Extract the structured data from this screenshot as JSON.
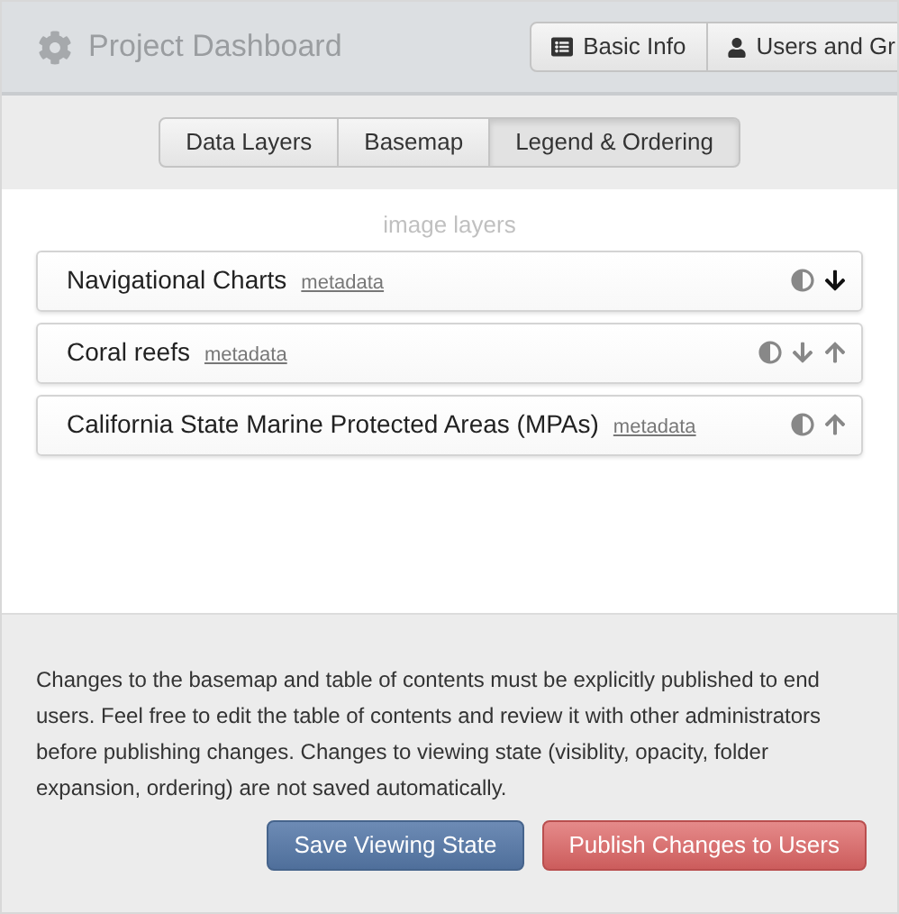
{
  "header": {
    "title": "Project Dashboard",
    "nav": [
      {
        "label": "Basic Info",
        "kind": "list"
      },
      {
        "label": "Users and Gr",
        "kind": "user"
      }
    ]
  },
  "tabs": [
    {
      "label": "Data Layers",
      "selected": false
    },
    {
      "label": "Basemap",
      "selected": false
    },
    {
      "label": "Legend & Ordering",
      "selected": true
    }
  ],
  "section_label": "image layers",
  "layers": [
    {
      "name": "Navigational Charts",
      "link": "metadata",
      "controls": [
        {
          "kind": "opacity",
          "active": false
        },
        {
          "kind": "down",
          "active": true
        }
      ]
    },
    {
      "name": "Coral reefs",
      "link": "metadata",
      "controls": [
        {
          "kind": "opacity",
          "active": false
        },
        {
          "kind": "down",
          "active": false
        },
        {
          "kind": "up",
          "active": false
        }
      ]
    },
    {
      "name": "California State Marine Protected Areas (MPAs)",
      "link": "metadata",
      "controls": [
        {
          "kind": "opacity",
          "active": false
        },
        {
          "kind": "up",
          "active": false
        }
      ]
    }
  ],
  "notice": "Changes to the basemap and table of contents must be explicitly published to end users. Feel free to edit the table of contents and review it with other administrators before publishing changes. Changes to viewing state (visiblity, opacity, folder expansion, ordering) are not saved automatically.",
  "buttons": [
    {
      "label": "Save Viewing State",
      "kind": "primary"
    },
    {
      "label": "Publish Changes to Users",
      "kind": "danger"
    }
  ]
}
